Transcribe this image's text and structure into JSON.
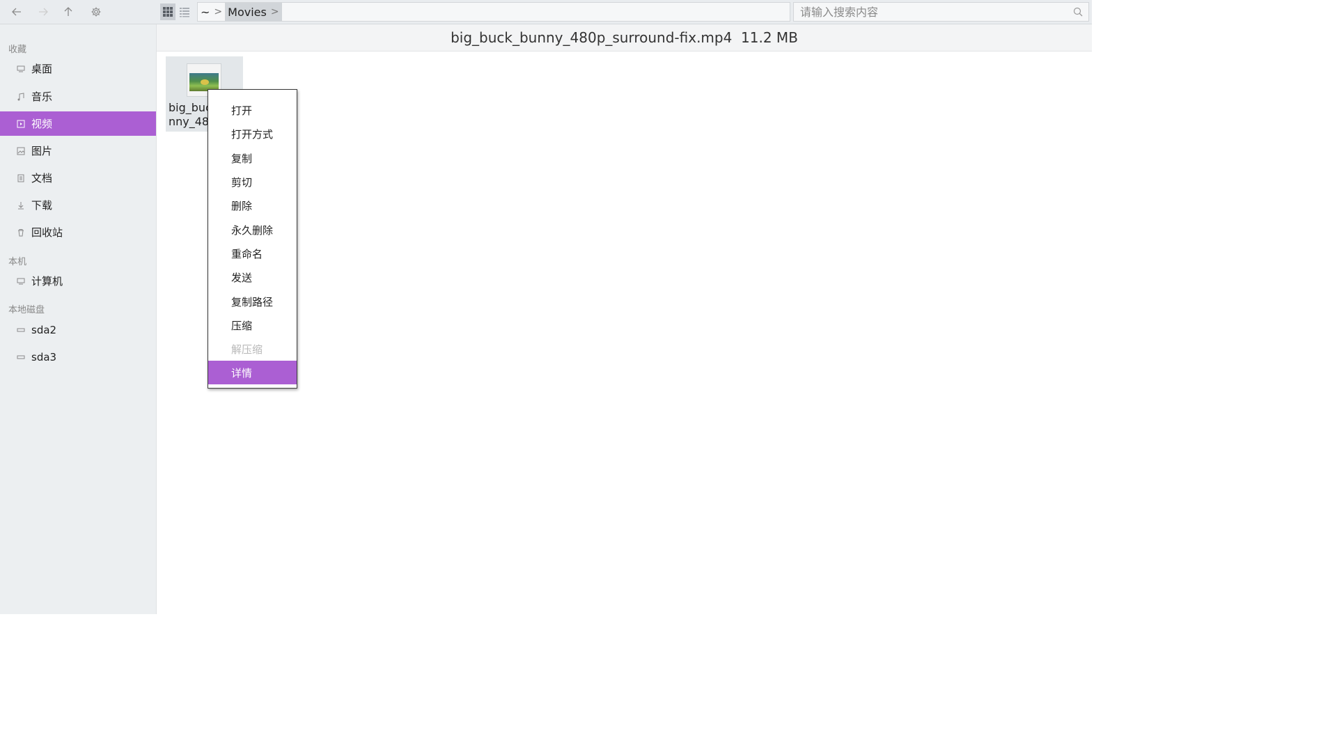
{
  "toolbar": {
    "back_icon": "arrow-left-icon",
    "forward_icon": "arrow-right-icon",
    "up_icon": "arrow-up-icon",
    "settings_icon": "gear-icon",
    "grid_view_icon": "grid-icon",
    "list_view_icon": "list-icon",
    "breadcrumb": [
      {
        "label": "~"
      },
      {
        "label": "Movies"
      }
    ],
    "search_placeholder": "请输入搜索内容",
    "search_value": ""
  },
  "sidebar": {
    "sections": [
      {
        "title": "收藏",
        "items": [
          {
            "label": "桌面",
            "icon": "desktop-icon"
          },
          {
            "label": "音乐",
            "icon": "music-icon"
          },
          {
            "label": "视频",
            "icon": "video-icon",
            "selected": true
          },
          {
            "label": "图片",
            "icon": "image-icon"
          },
          {
            "label": "文档",
            "icon": "document-icon"
          },
          {
            "label": "下载",
            "icon": "download-icon"
          },
          {
            "label": "回收站",
            "icon": "trash-icon"
          }
        ]
      },
      {
        "title": "本机",
        "items": [
          {
            "label": "计算机",
            "icon": "computer-icon"
          }
        ]
      },
      {
        "title": "本地磁盘",
        "items": [
          {
            "label": "sda2",
            "icon": "drive-icon"
          },
          {
            "label": "sda3",
            "icon": "drive-icon"
          }
        ]
      }
    ]
  },
  "status": {
    "file_info": "big_buck_bunny_480p_surround-fix.mp4  11.2 MB"
  },
  "file": {
    "name_line1": "big_buck_bu",
    "name_line2": "nny_480p_s"
  },
  "context_menu": {
    "items": [
      {
        "label": "打开"
      },
      {
        "label": "打开方式"
      },
      {
        "label": "复制"
      },
      {
        "label": "剪切"
      },
      {
        "label": "删除"
      },
      {
        "label": "永久删除"
      },
      {
        "label": "重命名"
      },
      {
        "label": "发送"
      },
      {
        "label": "复制路径"
      },
      {
        "label": "压缩"
      },
      {
        "label": "解压缩",
        "disabled": true
      },
      {
        "label": "详情",
        "highlighted": true
      }
    ]
  },
  "colors": {
    "accent": "#ab5fd3",
    "sidebar_bg": "#eceff1",
    "toolbar_bg": "#e9ecef"
  }
}
